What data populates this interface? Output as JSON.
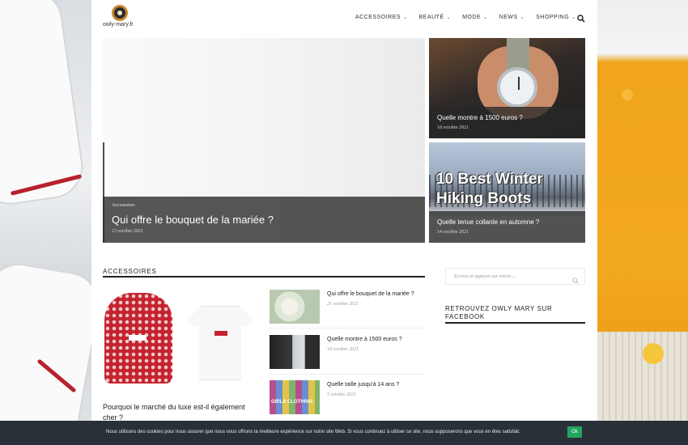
{
  "brand": {
    "logo_text": "owly-mary.fr"
  },
  "nav": {
    "items": [
      {
        "label": "ACCESSOIRES"
      },
      {
        "label": "BEAUTÉ"
      },
      {
        "label": "MODE"
      },
      {
        "label": "NEWS"
      },
      {
        "label": "SHOPPING"
      }
    ],
    "chevron_icon": "chevron-down-icon",
    "search_icon": "search-icon"
  },
  "hero": {
    "main": {
      "category": "Accessoires",
      "title": "Qui offre le bouquet de la mariée ?",
      "date": "23 octobre 2021"
    },
    "side": [
      {
        "title": "Quelle montre à 1500 euros ?",
        "date": "18 octobre 2021"
      },
      {
        "image_text_line1": "10 Best Winter",
        "image_text_line2": "Hiking Boots",
        "title": "Quelle tenue collante en automne ?",
        "date": "14 octobre 2021"
      }
    ]
  },
  "section": {
    "title": "ACCESSOIRES",
    "featured": {
      "title": "Pourquoi le marché du luxe est-il également cher ?"
    },
    "posts": [
      {
        "title": "Qui offre le bouquet de la mariée ?",
        "date": "21 octobre 2021"
      },
      {
        "title": "Quelle montre à 1500 euros ?",
        "date": "18 octobre 2021"
      },
      {
        "title": "Quelle taille jusqu'à 14 ans ?",
        "date": "2 octobre 2021",
        "thumb_text": "GIRLS CLOTHING"
      }
    ]
  },
  "sidebar": {
    "search_placeholder": "Ecrivez et appuyez sur entrée ...",
    "facebook_title": "RETROUVEZ OWLY MARY SUR FACEBOOK"
  },
  "cookie": {
    "text": "Nous utilisons des cookies pour nous assurer que nous vous offrons la meilleure expérience sur notre site Web. Si vous continuez à utiliser ce site, nous supposerons que vous en êtes satisfait.",
    "ok_label": "Ok",
    "ok_color": "#23a561"
  }
}
